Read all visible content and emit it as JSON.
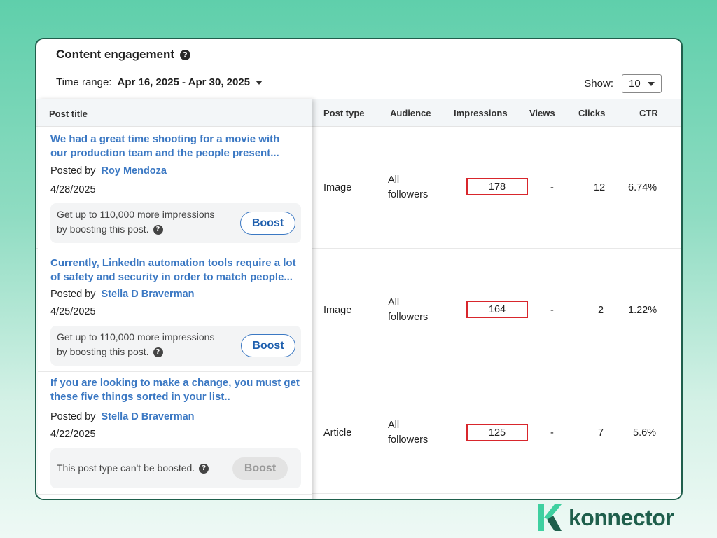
{
  "title": "Content engagement",
  "filters": {
    "time_range_label": "Time range:",
    "time_range_value": "Apr 16, 2025 - Apr 30, 2025",
    "show_label": "Show:",
    "show_value": "10"
  },
  "table": {
    "headers": {
      "post_title": "Post title",
      "post_type": "Post type",
      "audience": "Audience",
      "impressions": "Impressions",
      "views": "Views",
      "clicks": "Clicks",
      "ctr": "CTR"
    },
    "rows": [
      {
        "title_line1": "We had a great time shooting for a movie with",
        "title_line2": "our production team and the  people present...",
        "posted_by_label": "Posted by",
        "author": "Roy Mendoza",
        "date": "4/28/2025",
        "boost_line1": "Get up to 110,000 more impressions",
        "boost_line2": "by boosting this post.",
        "boost_button": "Boost",
        "post_type": "Image",
        "audience_line1": "All",
        "audience_line2": "followers",
        "impressions": "178",
        "views": "-",
        "clicks": "12",
        "ctr": "6.74%"
      },
      {
        "title_line1": "Currently, LinkedIn automation tools require a lot",
        "title_line2": "of safety and security in order to match people...",
        "posted_by_label": "Posted by",
        "author": "Stella D Braverman",
        "date": "4/25/2025",
        "boost_line1": "Get up to 110,000 more impressions",
        "boost_line2": "by boosting this post.",
        "boost_button": "Boost",
        "post_type": "Image",
        "audience_line1": "All",
        "audience_line2": "followers",
        "impressions": "164",
        "views": "-",
        "clicks": "2",
        "ctr": "1.22%"
      },
      {
        "title_line1": "If you are looking to make a change, you must get",
        "title_line2": "these five things sorted in your list..",
        "posted_by_label": "Posted by",
        "author": "Stella D Braverman",
        "date": "4/22/2025",
        "boost_line1": "This post type can't be boosted.",
        "boost_button": "Boost",
        "post_type": "Article",
        "audience_line1": "All",
        "audience_line2": "followers",
        "impressions": "125",
        "views": "-",
        "clicks": "7",
        "ctr": "5.6%"
      }
    ]
  },
  "brand": {
    "name": "konnector"
  },
  "colors": {
    "link_blue": "#3b78c3",
    "highlight_red": "#d8262c",
    "brand_green": "#1f5f4c",
    "accent_green": "#3fd0a0"
  },
  "icons": [
    "help-icon",
    "dropdown-caret-icon",
    "konnector-logo-icon"
  ]
}
